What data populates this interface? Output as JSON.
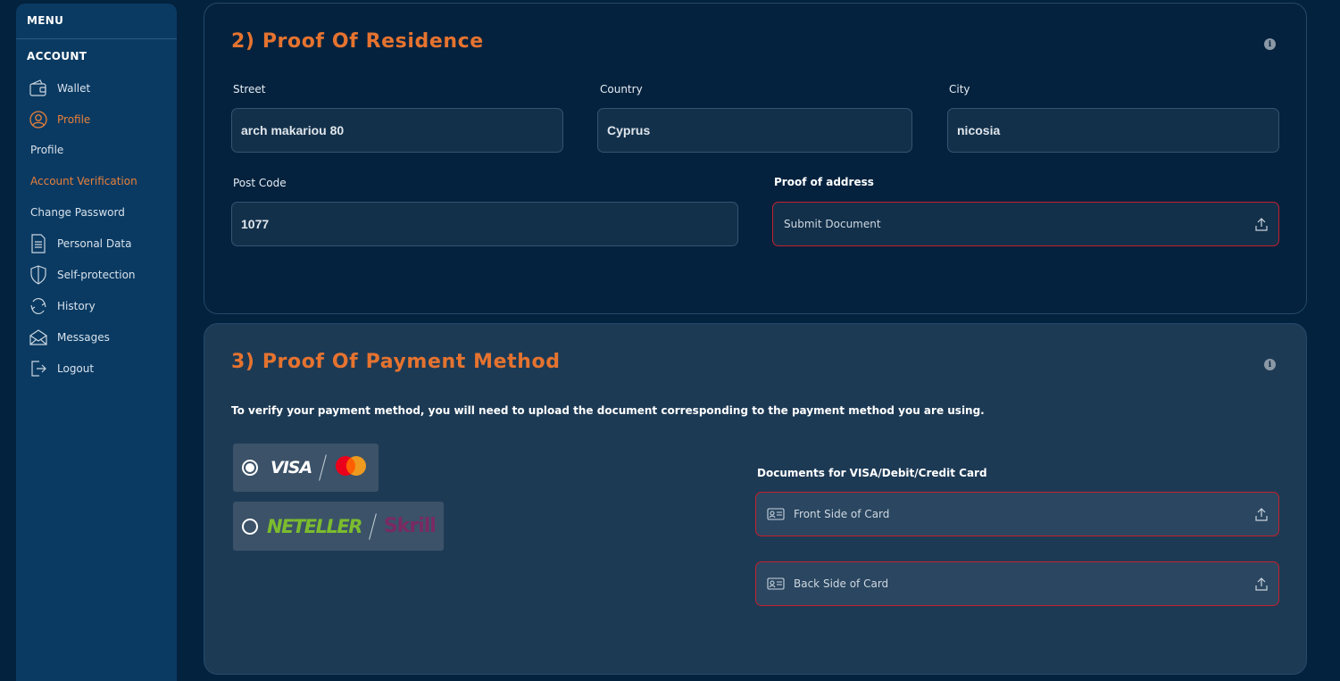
{
  "sidebar": {
    "menu_label": "MENU",
    "account_label": "ACCOUNT",
    "items": [
      {
        "label": "Wallet",
        "icon": "wallet-icon"
      },
      {
        "label": "Profile",
        "icon": "user-circle-icon"
      },
      {
        "label": "Personal Data",
        "icon": "document-icon"
      },
      {
        "label": "Self-protection",
        "icon": "shield-icon"
      },
      {
        "label": "History",
        "icon": "history-icon"
      },
      {
        "label": "Messages",
        "icon": "envelope-icon"
      },
      {
        "label": "Logout",
        "icon": "logout-icon"
      }
    ],
    "profile_sub": [
      "Profile",
      "Account Verification",
      "Change Password"
    ],
    "active_item": "Profile",
    "active_sub": "Account Verification"
  },
  "residence": {
    "title": "2) Proof Of Residence",
    "street_label": "Street",
    "street_value": "arch makariou 80",
    "country_label": "Country",
    "country_value": "Cyprus",
    "city_label": "City",
    "city_value": "nicosia",
    "postcode_label": "Post Code",
    "postcode_value": "1077",
    "proof_label": "Proof of address",
    "proof_button": "Submit Document"
  },
  "payment": {
    "title": "3) Proof Of Payment Method",
    "note": "To verify your payment method, you will need to upload the document corresponding to the payment method you are using.",
    "option_visa": "VISA",
    "option_neteller": "NETELLER",
    "option_skrill": "Skrill",
    "selected": "visa-mastercard",
    "docs_label": "Documents for VISA/Debit/Credit Card",
    "front_label": "Front Side of Card",
    "back_label": "Back Side of Card"
  },
  "colors": {
    "accent": "#e5732f",
    "sidebar_bg": "#0a3a62",
    "page_bg": "#03223e",
    "error_border": "#c6202b",
    "mastercard_red": "#eb001b",
    "mastercard_orange": "#f79e1b"
  }
}
